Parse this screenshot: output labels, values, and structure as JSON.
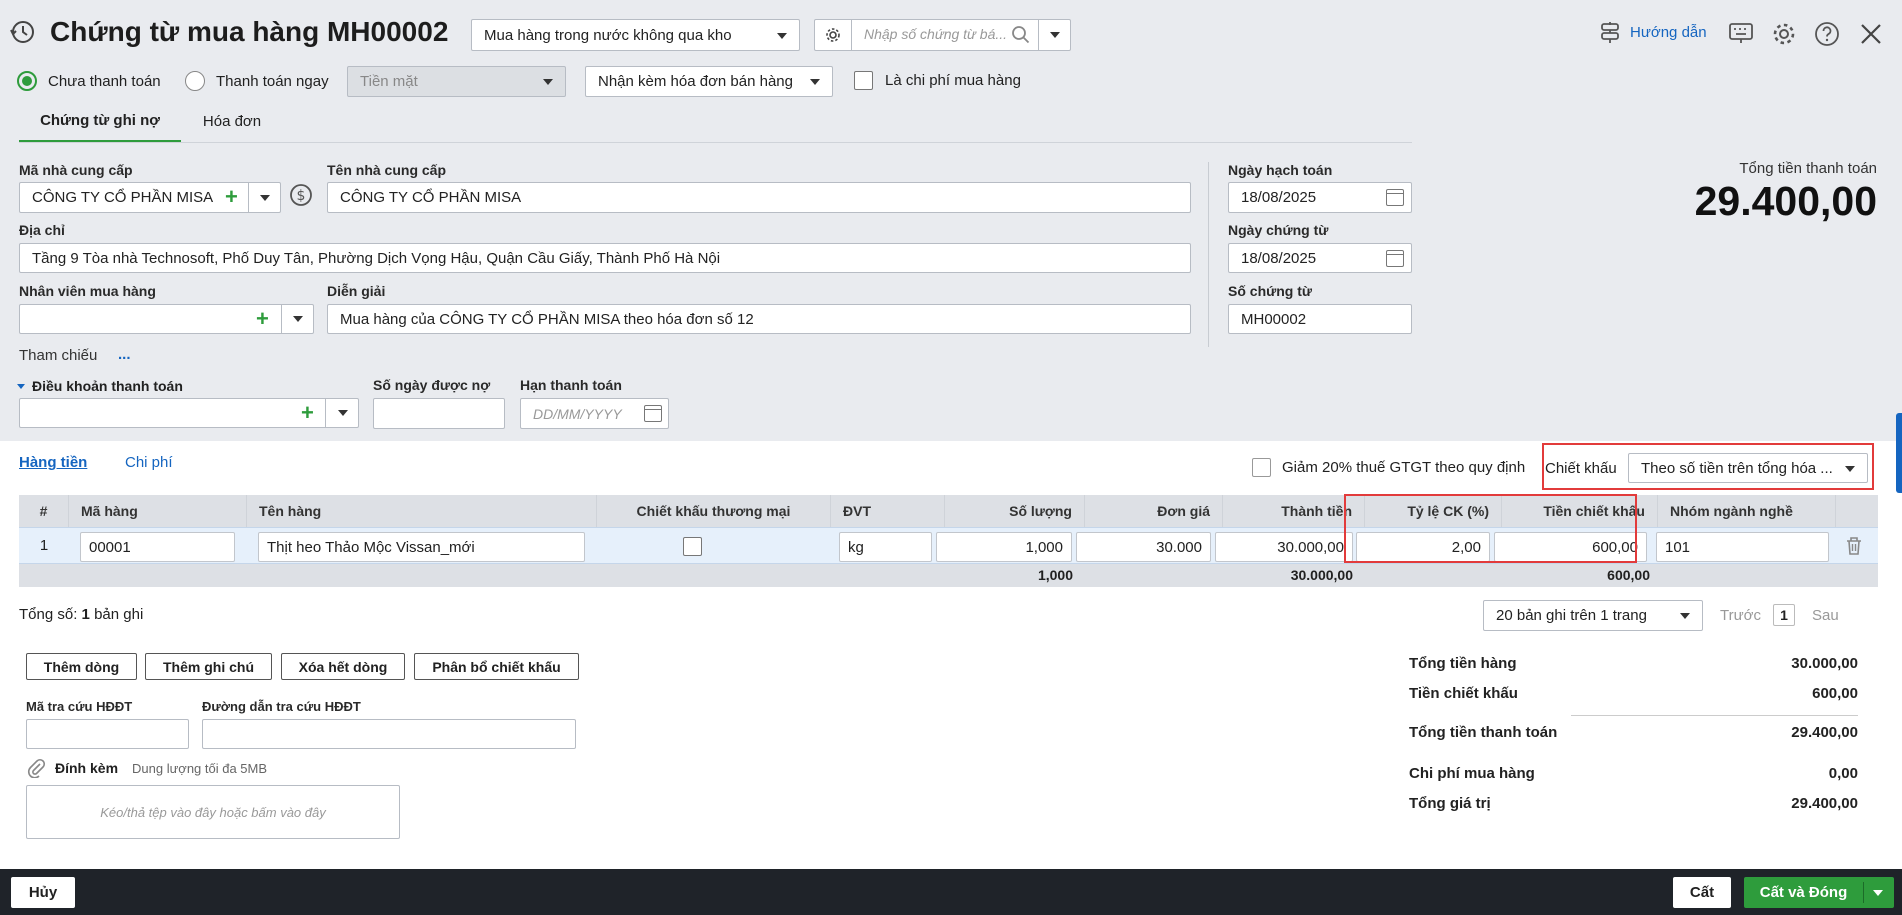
{
  "header": {
    "title": "Chứng từ mua hàng MH00002",
    "type_select": "Mua hàng trong nước không qua kho",
    "search_placeholder": "Nhập số chứng từ bá...",
    "help_label": "Hướng dẫn"
  },
  "options": {
    "unpaid_label": "Chưa thanh toán",
    "pay_now_label": "Thanh toán ngay",
    "pay_method": "Tiền mặt",
    "invoice_option": "Nhận kèm hóa đơn bán hàng",
    "is_expense_label": "Là chi phí mua hàng"
  },
  "tabs": [
    "Chứng từ ghi nợ",
    "Hóa đơn"
  ],
  "form": {
    "supplier_code_label": "Mã nhà cung cấp",
    "supplier_code": "CÔNG TY CỔ PHẦN MISA",
    "supplier_name_label": "Tên nhà cung cấp",
    "supplier_name": "CÔNG TY CỔ PHẦN MISA",
    "address_label": "Địa chỉ",
    "address": "Tầng 9 Tòa nhà Technosoft, Phố Duy Tân, Phường Dịch Vọng Hậu, Quận Cầu Giấy, Thành Phố Hà Nội",
    "employee_label": "Nhân viên mua hàng",
    "employee": "",
    "description_label": "Diễn giải",
    "description": "Mua hàng của CÔNG TY CỔ PHẦN MISA theo hóa đơn số 12",
    "reference_label": "Tham chiếu",
    "reference_more": "...",
    "payment_terms_label": "Điều khoản thanh toán",
    "payment_terms": "",
    "credit_days_label": "Số ngày được nợ",
    "credit_days": "",
    "due_date_label": "Hạn thanh toán",
    "due_date_placeholder": "DD/MM/YYYY",
    "posting_date_label": "Ngày hạch toán",
    "posting_date": "18/08/2025",
    "voucher_date_label": "Ngày chứng từ",
    "voucher_date": "18/08/2025",
    "voucher_no_label": "Số chứng từ",
    "voucher_no": "MH00002"
  },
  "total_box": {
    "label": "Tổng tiền thanh toán",
    "value": "29.400,00"
  },
  "detail_tabs": [
    "Hàng tiền",
    "Chi phí"
  ],
  "vat_reduce_label": "Giảm 20% thuế GTGT theo quy định",
  "discount": {
    "label": "Chiết khấu",
    "value": "Theo số tiền trên tổng hóa ..."
  },
  "table": {
    "columns": [
      "#",
      "Mã hàng",
      "Tên hàng",
      "Chiết khấu thương mại",
      "ĐVT",
      "Số lượng",
      "Đơn giá",
      "Thành tiền",
      "Tỷ lệ CK (%)",
      "Tiền chiết khấu",
      "Nhóm ngành nghề"
    ],
    "rows": [
      {
        "no": "1",
        "code": "00001",
        "name": "Thịt heo Thảo Mộc Vissan_mới",
        "unit": "kg",
        "qty": "1,000",
        "price": "30.000",
        "amount": "30.000,00",
        "ck_rate": "2,00",
        "ck_amount": "600,00",
        "group": "101"
      }
    ],
    "totals": {
      "qty": "1,000",
      "amount": "30.000,00",
      "ck_amount": "600,00"
    }
  },
  "footer_list": {
    "count_prefix": "Tổng số:",
    "count": "1",
    "count_suffix": "bản ghi",
    "page_size": "20 bản ghi trên 1 trang",
    "prev": "Trước",
    "page": "1",
    "next": "Sau"
  },
  "actions": [
    "Thêm dòng",
    "Thêm ghi chú",
    "Xóa hết dòng",
    "Phân bổ chiết khấu"
  ],
  "einvoice": {
    "lookup_code_label": "Mã tra cứu HĐĐT",
    "lookup_url_label": "Đường dẫn tra cứu HĐĐT"
  },
  "attach": {
    "label": "Đính kèm",
    "hint": "Dung lượng tối đa 5MB",
    "drop": "Kéo/thả tệp vào đây hoặc bấm vào đây"
  },
  "summary": [
    {
      "label": "Tổng tiền hàng",
      "value": "30.000,00"
    },
    {
      "label": "Tiền chiết khấu",
      "value": "600,00"
    },
    {
      "label": "Tổng tiền thanh toán",
      "value": "29.400,00"
    },
    {
      "label": "Chi phí mua hàng",
      "value": "0,00"
    },
    {
      "label": "Tổng giá trị",
      "value": "29.400,00"
    }
  ],
  "bottom": {
    "cancel": "Hủy",
    "save": "Cất",
    "save_close": "Cất và Đóng"
  },
  "colors": {
    "accent": "#1e8e3e",
    "link": "#1565c0",
    "highlight": "#e23b3b"
  }
}
